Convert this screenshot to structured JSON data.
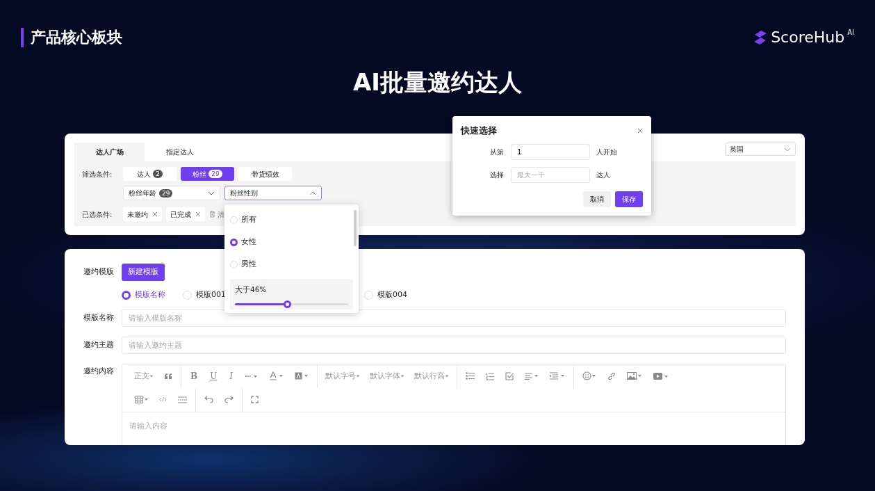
{
  "header": {
    "section_title": "产品核心板块",
    "logo_text": "ScoreHub",
    "logo_sup": "AI"
  },
  "headline": "AI批量邀约达人",
  "filter_card": {
    "tabs": [
      {
        "label": "达人广场",
        "selected": true
      },
      {
        "label": "指定达人",
        "selected": false
      }
    ],
    "country_select": "英国",
    "filter_label": "筛选条件:",
    "chips": [
      {
        "label": "达人",
        "count": "2",
        "selected": false
      },
      {
        "label": "粉丝",
        "count": "29",
        "selected": true
      },
      {
        "label": "带货绩效",
        "selected": false
      }
    ],
    "selects": [
      {
        "label": "粉丝年龄",
        "count": "29",
        "expanded": false
      },
      {
        "label": "粉丝性别",
        "expanded": true
      }
    ],
    "chosen_label": "已选条件:",
    "chosen_tags": [
      "未邀约",
      "已完成"
    ],
    "clear_text": "清"
  },
  "gender_dropdown": {
    "options": [
      {
        "label": "所有",
        "selected": false
      },
      {
        "label": "女性",
        "selected": true
      },
      {
        "label": "男性",
        "selected": false
      }
    ],
    "slider": {
      "reading": "大于46%",
      "level": 0.46
    }
  },
  "quick_select": {
    "title": "快速选择",
    "rows": [
      {
        "label": "从第",
        "value": "1",
        "suffix": "人开始"
      },
      {
        "label": "选择",
        "placeholder": "最大一千",
        "suffix": "达人"
      }
    ],
    "buttons": [
      "取消",
      "保存"
    ]
  },
  "template_card": {
    "template_label": "邀约模版",
    "new_button": "新建模版",
    "templates": [
      {
        "label": "模版名称",
        "selected": true
      },
      {
        "label": "模版001",
        "selected": false
      },
      {
        "label": "模版004",
        "selected": false
      }
    ],
    "fields": [
      {
        "label": "模版名称",
        "placeholder": "请输入模版名称"
      },
      {
        "label": "邀约主题",
        "placeholder": "请输入邀约主题"
      }
    ],
    "content_label": "邀约内容",
    "editor": {
      "dropdowns": [
        "正文",
        "默认字号",
        "默认字体",
        "默认行高"
      ],
      "glyphs": [
        "B",
        "U",
        "I"
      ],
      "placeholder": "请输入内容"
    }
  }
}
